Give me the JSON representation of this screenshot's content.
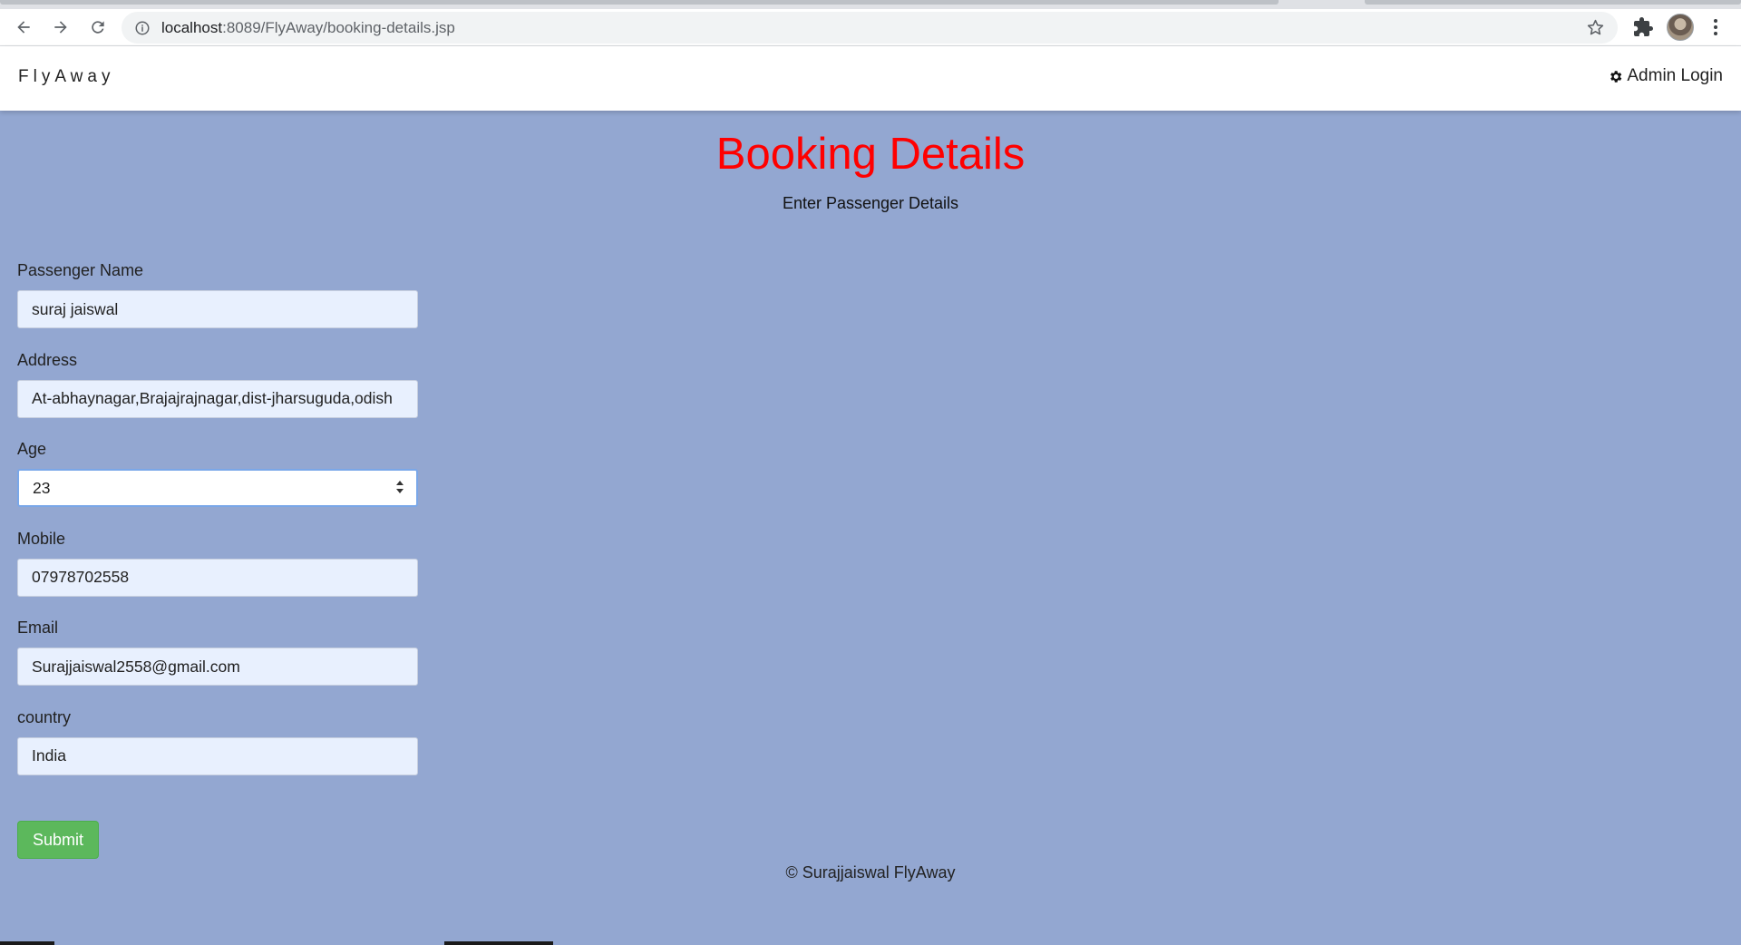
{
  "browser": {
    "url_host": "localhost",
    "url_rest": ":8089/FlyAway/booking-details.jsp"
  },
  "navbar": {
    "brand": "FlyAway",
    "admin_login": "Admin Login"
  },
  "page": {
    "title": "Booking Details",
    "subtitle": "Enter Passenger Details"
  },
  "form": {
    "fields": [
      {
        "label": "Passenger Name",
        "value": "suraj jaiswal"
      },
      {
        "label": "Address",
        "value": "At-abhaynagar,Brajajrajnagar,dist-jharsuguda,odish"
      },
      {
        "label": "Age",
        "value": "23"
      },
      {
        "label": "Mobile",
        "value": "07978702558"
      },
      {
        "label": "Email",
        "value": "Surajjaiswal2558@gmail.com"
      },
      {
        "label": "country",
        "value": "India"
      }
    ],
    "submit_label": "Submit"
  },
  "footer": {
    "text": "© Surajjaiswal FlyAway"
  },
  "colors": {
    "page_background": "#93a7d1",
    "title": "#ff0000",
    "submit_button": "#5cb85c",
    "input_background": "#e8f0fe"
  },
  "icons": [
    "back-icon",
    "forward-icon",
    "reload-icon",
    "info-icon",
    "star-icon",
    "extensions-icon",
    "profile-avatar",
    "menu-icon",
    "gear-icon",
    "spinner-icon"
  ]
}
